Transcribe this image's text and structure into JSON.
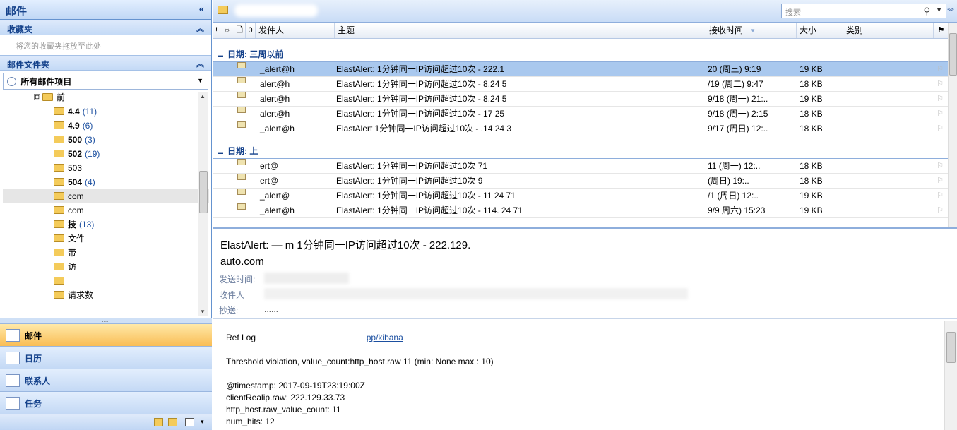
{
  "nav": {
    "title": "邮件",
    "collapse_glyph": "«",
    "favorites": {
      "header": "收藏夹",
      "hint": "将您的收藏夹拖放至此处"
    },
    "folders": {
      "header": "邮件文件夹",
      "all_items": "所有邮件项目"
    },
    "tree": [
      {
        "name": "前",
        "count": "",
        "toggle": "⊟",
        "indent": 1
      },
      {
        "name": "4.4",
        "count": "(11)",
        "bold": true
      },
      {
        "name": "4.9",
        "count": "(6)",
        "bold": true
      },
      {
        "name": "500",
        "count": "(3)",
        "bold": true
      },
      {
        "name": "502",
        "count": "(19)",
        "bold": true
      },
      {
        "name": "503",
        "count": ""
      },
      {
        "name": "504",
        "count": "(4)",
        "bold": true
      },
      {
        "name": "com",
        "count": "",
        "selected": true
      },
      {
        "name": "com",
        "count": ""
      },
      {
        "name": "技",
        "count": "(13)",
        "bold": true
      },
      {
        "name": "文件",
        "count": ""
      },
      {
        "name": "带",
        "count": ""
      },
      {
        "name": "访",
        "count": ""
      },
      {
        "name": "",
        "count": ""
      },
      {
        "name": "请求数",
        "count": ""
      }
    ],
    "buttons": [
      {
        "label": "邮件",
        "icon": "mail-icon",
        "active": true
      },
      {
        "label": "日历",
        "icon": "calendar-icon"
      },
      {
        "label": "联系人",
        "icon": "contacts-icon"
      },
      {
        "label": "任务",
        "icon": "tasks-icon"
      }
    ]
  },
  "list": {
    "search_placeholder": "搜索",
    "columns": {
      "importance": "!",
      "reminder": "☼",
      "icon": "🗋",
      "attachment": "0",
      "from": "发件人",
      "subject": "主题",
      "received": "接收时间",
      "size": "大小",
      "category": "类别",
      "flag": "⚑"
    },
    "groups": [
      {
        "label": "日期: 三周以前",
        "rows": [
          {
            "from": "_alert@h",
            "subject": "ElastAlert: 1分钟同一IP访问超过10次 - 222.1",
            "received": "20 (周三) 9:19",
            "size": "19 KB",
            "selected": true
          },
          {
            "from": "alert@h",
            "subject": "ElastAlert: 1分钟同一IP访问超过10次 - 8.24 5",
            "received": "/19 (周二) 9:47",
            "size": "18 KB"
          },
          {
            "from": "alert@h",
            "subject": "ElastAlert: 1分钟同一IP访问超过10次 - 8.24 5",
            "received": "9/18 (周一) 21:..",
            "size": "19 KB"
          },
          {
            "from": "alert@h",
            "subject": "ElastAlert: 1分钟同一IP访问超过10次 - 17 25",
            "received": "9/18 (周一) 2:15",
            "size": "18 KB"
          },
          {
            "from": "_alert@h",
            "subject": "ElastAlert 1分钟同一IP访问超过10次 - .14 24 3",
            "received": "9/17 (周日) 12:..",
            "size": "18 KB"
          }
        ]
      },
      {
        "label": "日期: 上",
        "rows": [
          {
            "from": "ert@",
            "subject": "ElastAlert: 1分钟同一IP访问超过10次 71",
            "received": "11 (周一) 12:..",
            "size": "18 KB"
          },
          {
            "from": "ert@",
            "subject": "ElastAlert: 1分钟同一IP访问超过10次 9",
            "received": "(周日) 19:..",
            "size": "18 KB"
          },
          {
            "from": "_alert@",
            "subject": "ElastAlert: 1分钟同一IP访问超过10次 - 11 24 71",
            "received": "/1 (周日) 12:..",
            "size": "19 KB"
          },
          {
            "from": "_alert@h",
            "subject": "ElastAlert: 1分钟同一IP访问超过10次 - 114. 24 71",
            "received": "9/9 周六) 15:23",
            "size": "19 KB"
          }
        ]
      }
    ]
  },
  "preview": {
    "subject": "ElastAlert: — m 1分钟同一IP访问超过10次 - 222.129.",
    "sender": "auto.com",
    "sent_label": "发送时间:",
    "to_label": "收件人",
    "cc_label": "抄送:",
    "cc_value": "......",
    "body": {
      "ref_prefix": "Ref Log",
      "ref_link": "pp/kibana",
      "threshold": "Threshold violation, value_count:http_host.raw 11 (min: None max : 10)",
      "timestamp": "@timestamp: 2017-09-19T23:19:00Z",
      "client_ip": "clientRealip.raw: 222.129.33.73",
      "host_count": "http_host.raw_value_count: 11",
      "num_hits": "num_hits: 12"
    }
  },
  "colors": {
    "accent": "#15428b",
    "selected_row": "#a9c8ee",
    "active_nav": "#f9bd55"
  }
}
